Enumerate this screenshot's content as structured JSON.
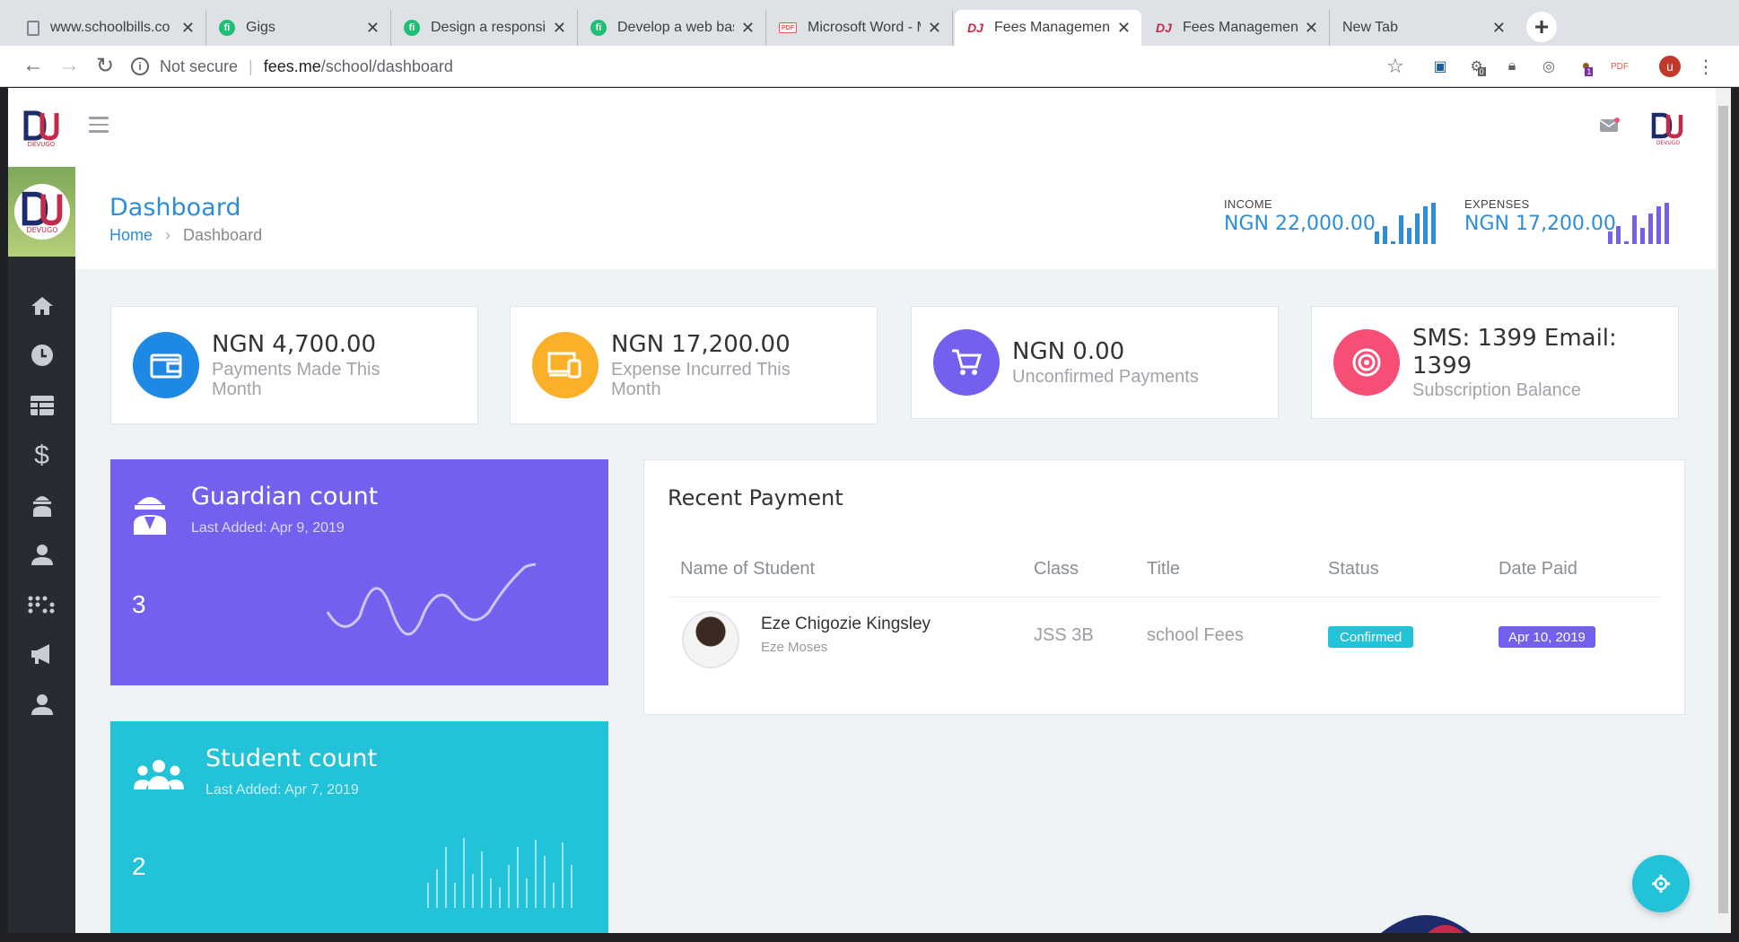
{
  "browser": {
    "tabs": [
      {
        "title": "www.schoolbills.co",
        "icon": "document-icon"
      },
      {
        "title": "Gigs",
        "icon": "fiverr-icon"
      },
      {
        "title": "Design a responsive",
        "icon": "fiverr-icon"
      },
      {
        "title": "Develop a web bas",
        "icon": "fiverr-icon"
      },
      {
        "title": "Microsoft Word - M",
        "icon": "pdf-icon"
      },
      {
        "title": "Fees Management |",
        "icon": "devugo-icon"
      },
      {
        "title": "Fees Management |",
        "icon": "devugo-icon"
      },
      {
        "title": "New Tab",
        "icon": ""
      }
    ],
    "active_tab": 5,
    "security": "Not secure",
    "url_host": "fees.me",
    "url_path": "/school/dashboard",
    "extension_badges": {
      "first": "0",
      "second": "1"
    },
    "profile_initial": "u"
  },
  "header": {
    "title": "Dashboard",
    "breadcrumb": {
      "home": "Home",
      "current": "Dashboard"
    },
    "income": {
      "label": "INCOME",
      "value": "NGN 22,000.00"
    },
    "expenses": {
      "label": "EXPENSES",
      "value": "NGN 17,200.00"
    }
  },
  "stats": [
    {
      "value": "NGN 4,700.00",
      "line1": "Payments Made This",
      "line2": "Month",
      "color": "#1e88e5",
      "icon": "wallet-icon"
    },
    {
      "value": "NGN 17,200.00",
      "line1": "Expense Incurred This",
      "line2": "Month",
      "color": "#fbb02a",
      "icon": "devices-icon"
    },
    {
      "value": "NGN 0.00",
      "line1": "Unconfirmed Payments",
      "line2": "",
      "color": "#7460ee",
      "icon": "cart-icon"
    },
    {
      "value": "SMS: 1399 Email: 1399",
      "line1": "Subscription Balance",
      "line2": "",
      "color": "#f64e75",
      "icon": "target-icon"
    }
  ],
  "cards": {
    "guardian": {
      "title": "Guardian count",
      "sub": "Last Added: Apr 9, 2019",
      "count": "3",
      "color": "#7460ee"
    },
    "student": {
      "title": "Student count",
      "sub": "Last Added: Apr 7, 2019",
      "count": "2",
      "color": "#22c3d8"
    }
  },
  "recent": {
    "title": "Recent Payment",
    "columns": [
      "Name of Student",
      "Class",
      "Title",
      "Status",
      "Date Paid"
    ],
    "rows": [
      {
        "name": "Eze Chigozie Kingsley",
        "guardian": "Eze Moses",
        "class": "JSS 3B",
        "title": "school Fees",
        "status": "Confirmed",
        "date": "Apr 10, 2019"
      }
    ]
  },
  "colors": {
    "accent": "#2d8ed8",
    "sidebar": "#262c32",
    "confirmed": "#22c3d8",
    "date_badge": "#7460ee"
  }
}
